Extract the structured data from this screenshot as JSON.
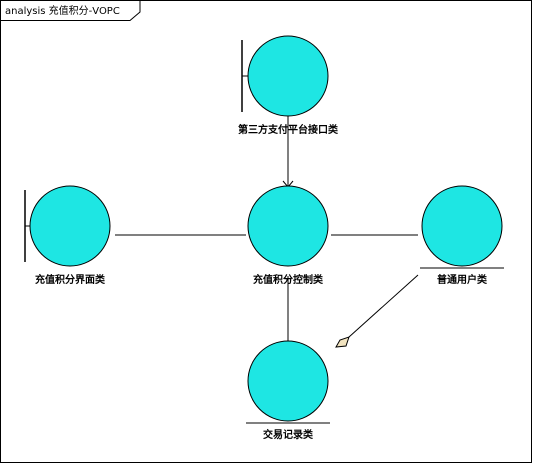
{
  "diagram": {
    "title": "analysis 充值积分-VOPC",
    "colors": {
      "sphere_fill": "#1ee6e3",
      "sphere_stroke": "#000000",
      "line": "#000000",
      "aggregation_fill": "#f2e4c0",
      "background": "#ffffff"
    },
    "nodes": [
      {
        "id": "payment_interface",
        "label": "第三方支付平台接口类",
        "stereotype": "boundary"
      },
      {
        "id": "recharge_ui",
        "label": "充值积分界面类",
        "stereotype": "boundary"
      },
      {
        "id": "recharge_control",
        "label": "充值积分控制类",
        "stereotype": "control"
      },
      {
        "id": "ordinary_user",
        "label": "普通用户类",
        "stereotype": "entity"
      },
      {
        "id": "transaction_record",
        "label": "交易记录类",
        "stereotype": "entity"
      }
    ],
    "edges": [
      {
        "from": "payment_interface",
        "to": "recharge_control",
        "kind": "association"
      },
      {
        "from": "recharge_ui",
        "to": "recharge_control",
        "kind": "association"
      },
      {
        "from": "recharge_control",
        "to": "ordinary_user",
        "kind": "association"
      },
      {
        "from": "recharge_control",
        "to": "transaction_record",
        "kind": "association"
      },
      {
        "from": "ordinary_user",
        "to": "transaction_record",
        "kind": "aggregation"
      }
    ]
  }
}
